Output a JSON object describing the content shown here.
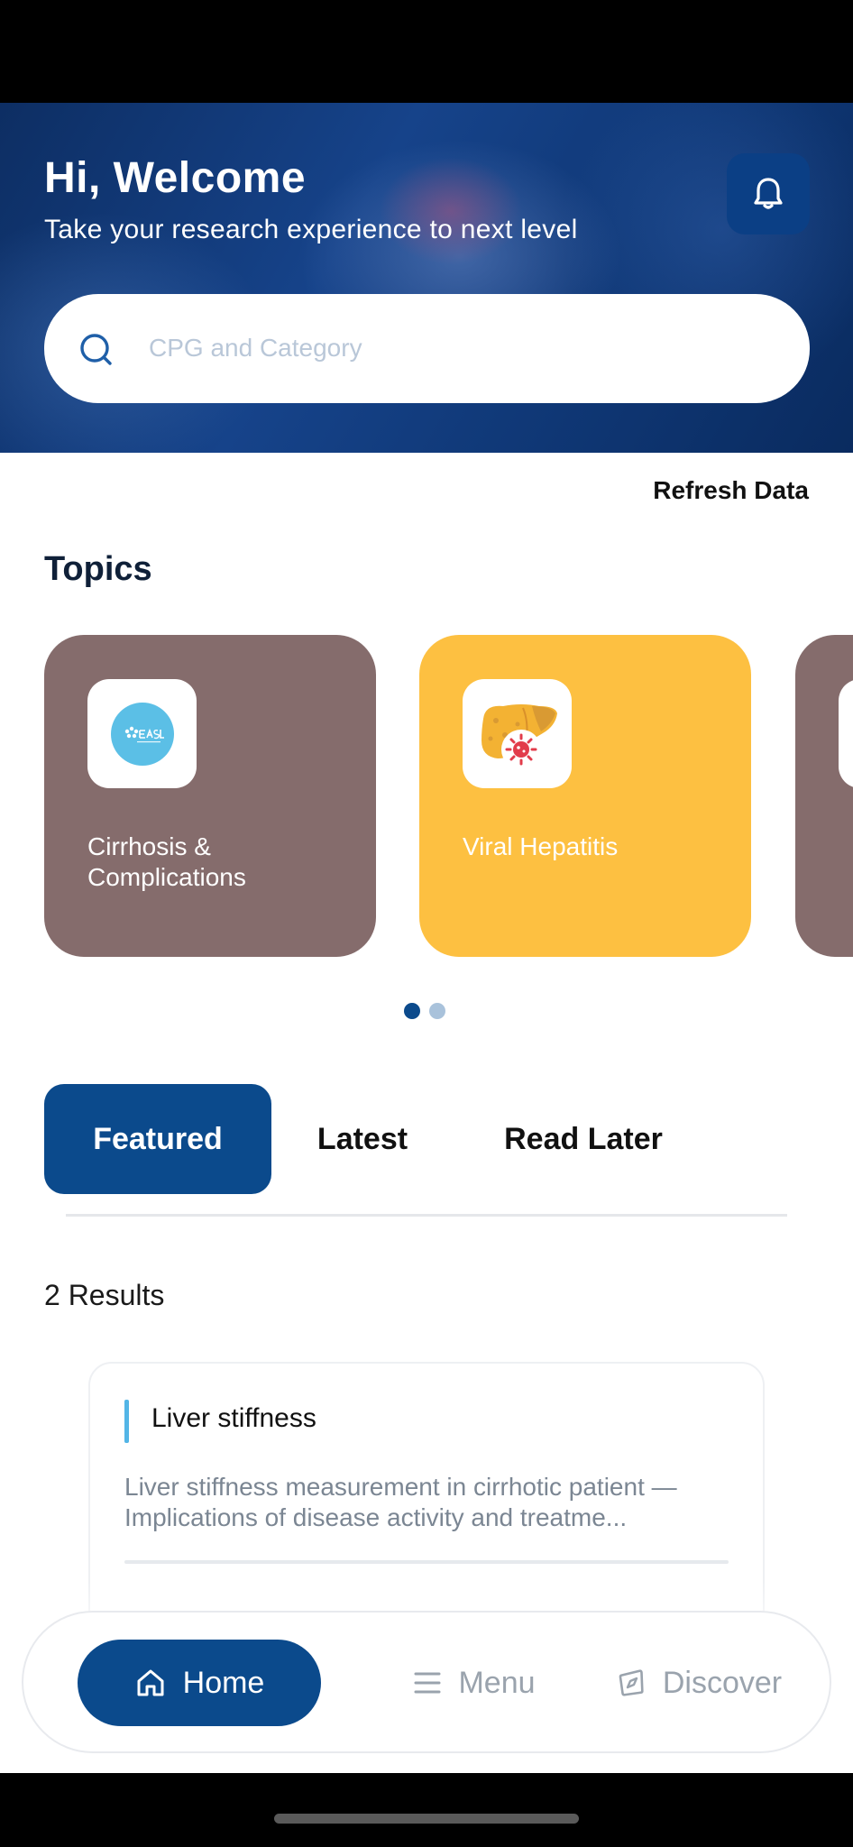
{
  "header": {
    "greeting": "Hi, Welcome",
    "subtitle": "Take your research experience to next level",
    "notification_icon": "bell-icon"
  },
  "search": {
    "placeholder": "CPG and Category",
    "value": "",
    "icon": "search-icon"
  },
  "refresh": {
    "label": "Refresh Data"
  },
  "topics": {
    "title": "Topics",
    "cards": [
      {
        "label": "Cirrhosis & Complications",
        "icon": "easl-logo",
        "color": "#856c6c"
      },
      {
        "label": "Viral Hepatitis",
        "icon": "liver-virus-icon",
        "color": "#fdc041"
      },
      {
        "label": "",
        "icon": "",
        "color": "#856c6c"
      }
    ],
    "pagination": {
      "active_index": 0,
      "count": 2
    }
  },
  "tabs": [
    {
      "label": "Featured",
      "active": true
    },
    {
      "label": "Latest",
      "active": false
    },
    {
      "label": "Read Later",
      "active": false
    }
  ],
  "results": {
    "count_label": "2 Results",
    "items": [
      {
        "title": "Liver stiffness",
        "description": "Liver stiffness measurement in cirrhotic patient — Implications of disease activity and treatme..."
      }
    ]
  },
  "bottom_nav": [
    {
      "label": "Home",
      "icon": "home-icon",
      "active": true
    },
    {
      "label": "Menu",
      "icon": "menu-icon",
      "active": false
    },
    {
      "label": "Discover",
      "icon": "compass-icon",
      "active": false
    }
  ],
  "colors": {
    "primary": "#0b4a8c",
    "hero_dark": "#0d2e63",
    "accent_bar": "#53b5e6",
    "card_brown": "#856c6c",
    "card_yellow": "#fdc041",
    "dot_active": "#0b4a8c",
    "dot_inactive": "#a9c2db"
  }
}
